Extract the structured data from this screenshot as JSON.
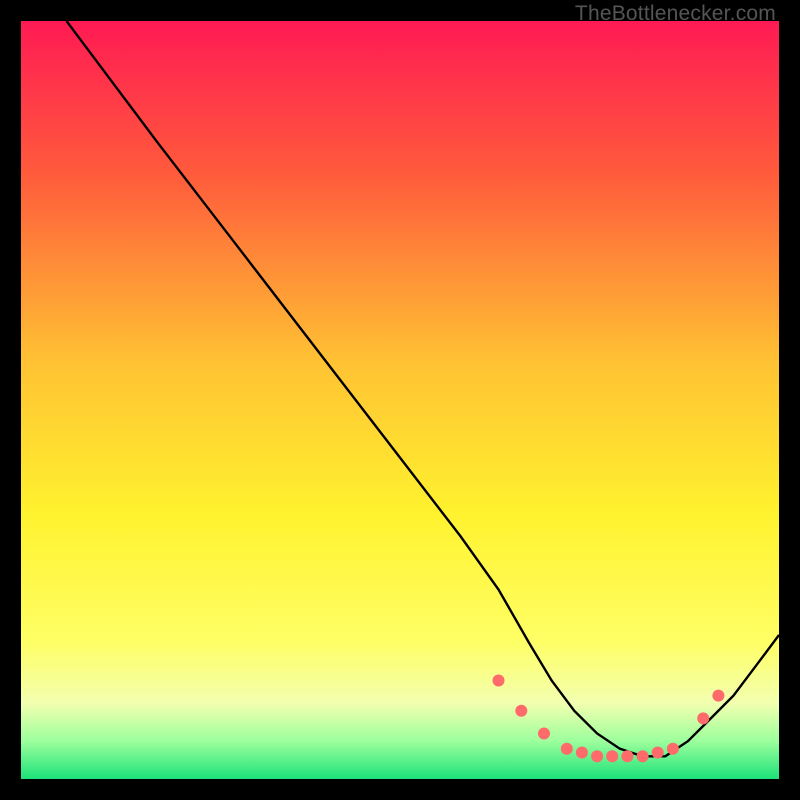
{
  "watermark": "TheBottlenecker.com",
  "chart_data": {
    "type": "line",
    "title": "",
    "xlabel": "",
    "ylabel": "",
    "xlim": [
      0,
      100
    ],
    "ylim": [
      0,
      100
    ],
    "grid": false,
    "legend": false,
    "gradient_stops": [
      {
        "offset": 0,
        "color": "#ff1a53"
      },
      {
        "offset": 20,
        "color": "#ff5a3c"
      },
      {
        "offset": 45,
        "color": "#ffc233"
      },
      {
        "offset": 65,
        "color": "#fff22e"
      },
      {
        "offset": 82,
        "color": "#ffff66"
      },
      {
        "offset": 90,
        "color": "#f2ffb0"
      },
      {
        "offset": 95,
        "color": "#9cff9c"
      },
      {
        "offset": 100,
        "color": "#1de27a"
      }
    ],
    "series": [
      {
        "name": "bottleneck-curve",
        "color": "#000000",
        "x": [
          6,
          9,
          18,
          28,
          38,
          48,
          58,
          63,
          67,
          70,
          73,
          76,
          79,
          82,
          85,
          88,
          91,
          94,
          97,
          100
        ],
        "y": [
          100,
          96,
          84,
          71,
          58,
          45,
          32,
          25,
          18,
          13,
          9,
          6,
          4,
          3,
          3,
          5,
          8,
          11,
          15,
          19
        ]
      }
    ],
    "markers": {
      "name": "optimal-range-dots",
      "color": "#ff6a6a",
      "radius": 6,
      "points": [
        {
          "x": 63,
          "y": 13
        },
        {
          "x": 66,
          "y": 9
        },
        {
          "x": 69,
          "y": 6
        },
        {
          "x": 72,
          "y": 4
        },
        {
          "x": 74,
          "y": 3.5
        },
        {
          "x": 76,
          "y": 3
        },
        {
          "x": 78,
          "y": 3
        },
        {
          "x": 80,
          "y": 3
        },
        {
          "x": 82,
          "y": 3
        },
        {
          "x": 84,
          "y": 3.5
        },
        {
          "x": 86,
          "y": 4
        },
        {
          "x": 90,
          "y": 8
        },
        {
          "x": 92,
          "y": 11
        }
      ]
    }
  }
}
